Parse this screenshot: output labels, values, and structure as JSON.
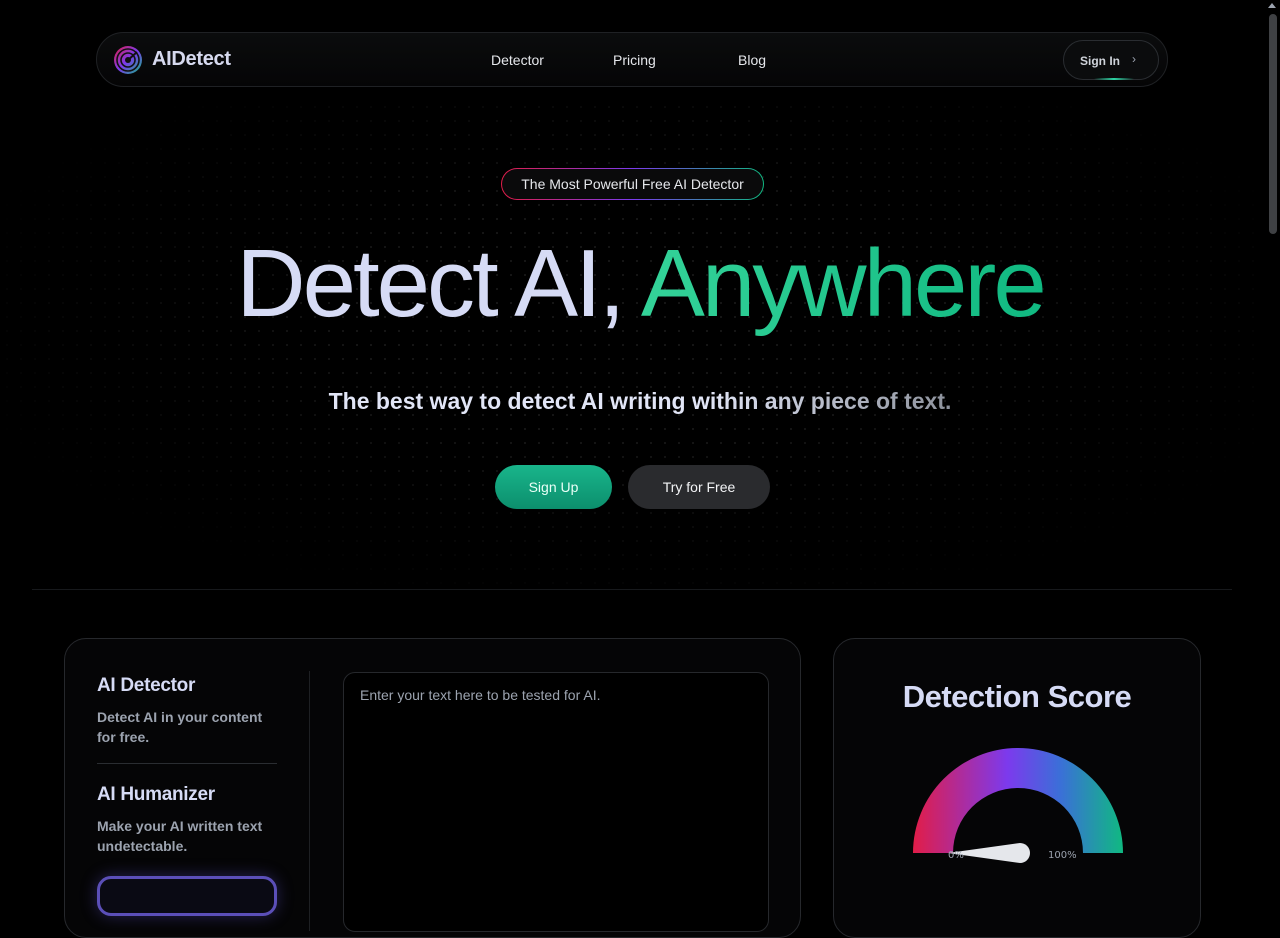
{
  "brand": {
    "name": "AIDetect"
  },
  "nav": {
    "links": [
      "Detector",
      "Pricing",
      "Blog"
    ],
    "sign_in": "Sign In"
  },
  "hero": {
    "badge": "The Most Powerful Free AI Detector",
    "title_part1": "Detect AI,",
    "title_part2": "Anywhere",
    "subtitle": "The best way to detect AI writing within any piece of text.",
    "primary_cta": "Sign Up",
    "secondary_cta": "Try for Free"
  },
  "tools": {
    "items": [
      {
        "title": "AI Detector",
        "desc": "Detect AI in your content for free."
      },
      {
        "title": "AI Humanizer",
        "desc": "Make your AI written text undetectable."
      }
    ]
  },
  "editor": {
    "placeholder": "Enter your text here to be tested for AI."
  },
  "score": {
    "title": "Detection Score",
    "min_label": "0%",
    "max_label": "100%",
    "value_fraction": 0
  },
  "colors": {
    "accent": "#10b981",
    "gauge_stops": [
      "#e11d48",
      "#7c3aed",
      "#10b981"
    ]
  }
}
